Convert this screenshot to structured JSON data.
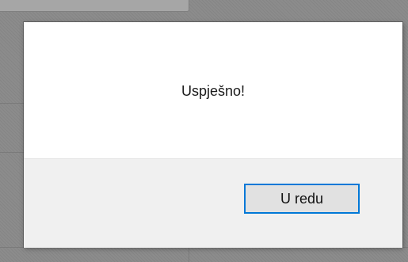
{
  "dialog": {
    "message": "Uspješno!",
    "ok_label": "U redu"
  },
  "colors": {
    "accent": "#0078d7",
    "footer_bg": "#f0f0f0",
    "button_bg": "#e1e1e1",
    "dialog_bg": "#ffffff"
  }
}
